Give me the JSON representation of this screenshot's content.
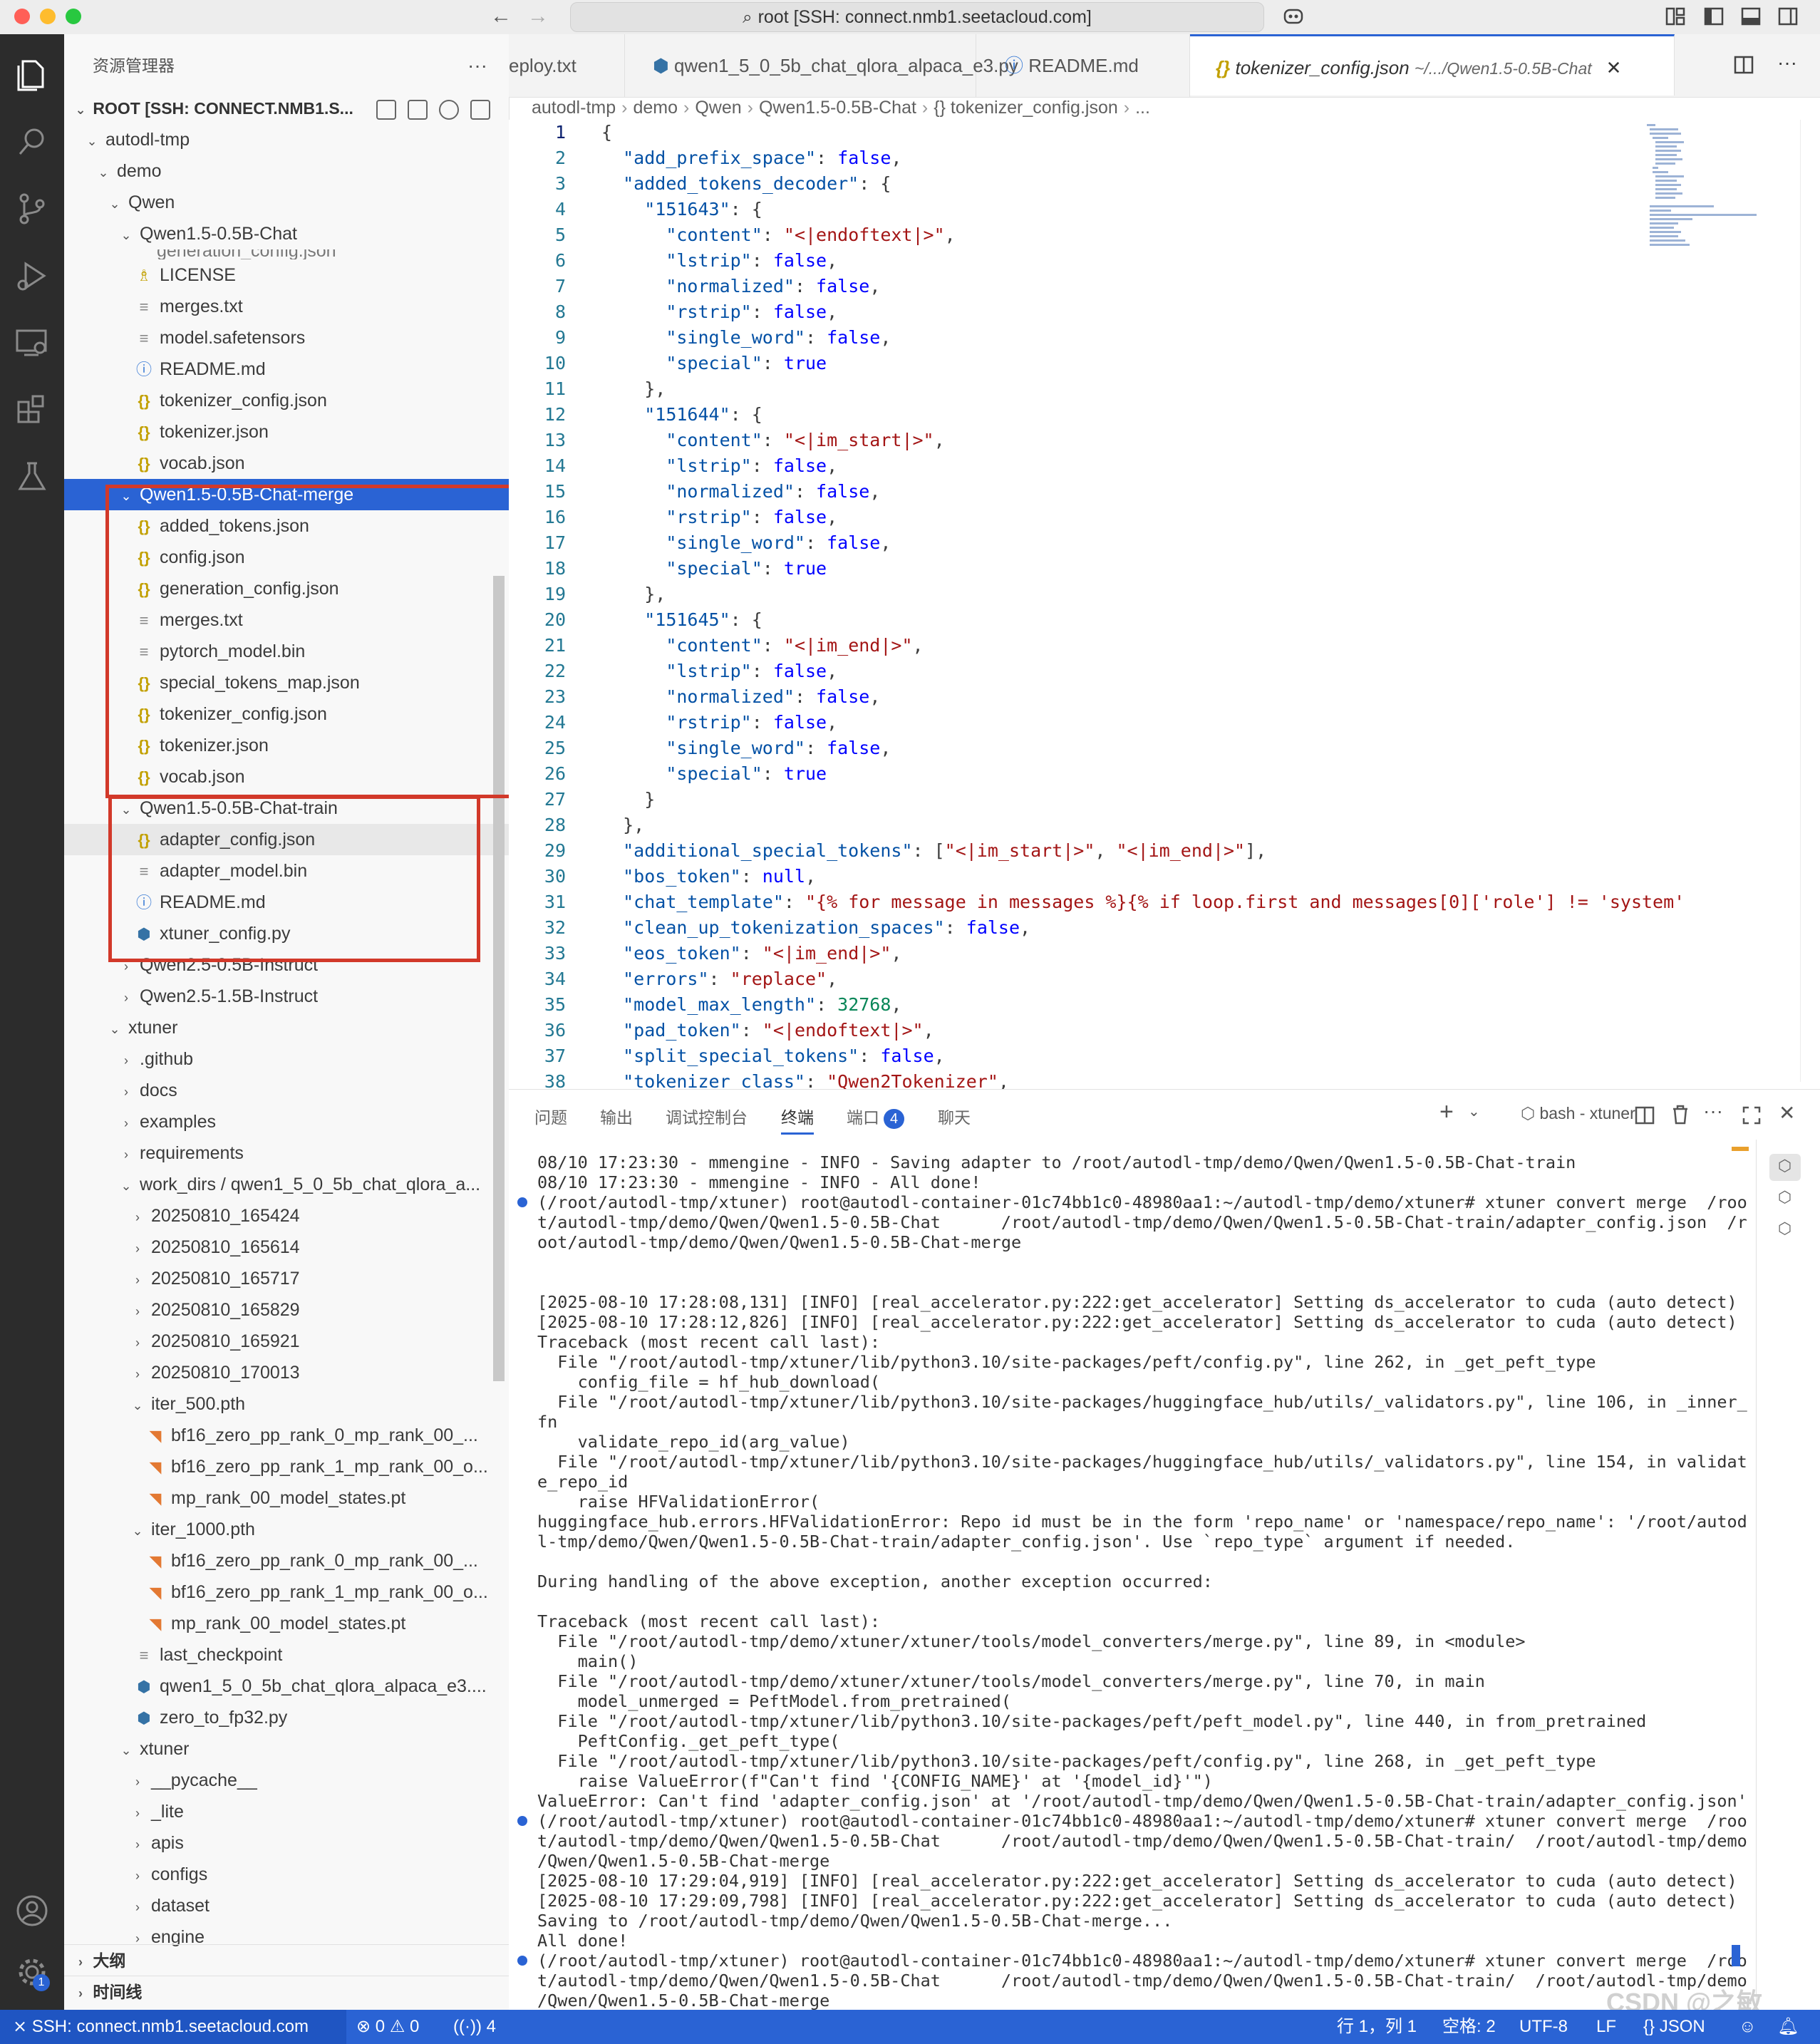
{
  "window": {
    "title": "root [SSH: connect.nmb1.seetacloud.com]",
    "nav_back": "←",
    "nav_forward": "→"
  },
  "sidebar": {
    "header": "资源管理器",
    "more": "···",
    "root_label": "ROOT [SSH: CONNECT.NMB1.S...",
    "tree": [
      {
        "label": "autodl-tmp",
        "indent": 1,
        "kind": "folder-open"
      },
      {
        "label": "demo",
        "indent": 2,
        "kind": "folder-open"
      },
      {
        "label": "Qwen",
        "indent": 3,
        "kind": "folder-open"
      },
      {
        "label": "Qwen1.5-0.5B-Chat",
        "indent": 4,
        "kind": "folder-open"
      },
      {
        "label": "LICENSE",
        "indent": 5,
        "kind": "lic"
      },
      {
        "label": "merges.txt",
        "indent": 5,
        "kind": "txt"
      },
      {
        "label": "model.safetensors",
        "indent": 5,
        "kind": "txt"
      },
      {
        "label": "README.md",
        "indent": 5,
        "kind": "info"
      },
      {
        "label": "tokenizer_config.json",
        "indent": 5,
        "kind": "json"
      },
      {
        "label": "tokenizer.json",
        "indent": 5,
        "kind": "json"
      },
      {
        "label": "vocab.json",
        "indent": 5,
        "kind": "json"
      },
      {
        "label": "Qwen1.5-0.5B-Chat-merge",
        "indent": 4,
        "kind": "folder-open",
        "selected": true
      },
      {
        "label": "added_tokens.json",
        "indent": 5,
        "kind": "json"
      },
      {
        "label": "config.json",
        "indent": 5,
        "kind": "json"
      },
      {
        "label": "generation_config.json",
        "indent": 5,
        "kind": "json"
      },
      {
        "label": "merges.txt",
        "indent": 5,
        "kind": "txt"
      },
      {
        "label": "pytorch_model.bin",
        "indent": 5,
        "kind": "txt"
      },
      {
        "label": "special_tokens_map.json",
        "indent": 5,
        "kind": "json"
      },
      {
        "label": "tokenizer_config.json",
        "indent": 5,
        "kind": "json"
      },
      {
        "label": "tokenizer.json",
        "indent": 5,
        "kind": "json"
      },
      {
        "label": "vocab.json",
        "indent": 5,
        "kind": "json"
      },
      {
        "label": "Qwen1.5-0.5B-Chat-train",
        "indent": 4,
        "kind": "folder-open"
      },
      {
        "label": "adapter_config.json",
        "indent": 5,
        "kind": "json",
        "hover": true
      },
      {
        "label": "adapter_model.bin",
        "indent": 5,
        "kind": "txt"
      },
      {
        "label": "README.md",
        "indent": 5,
        "kind": "info"
      },
      {
        "label": "xtuner_config.py",
        "indent": 5,
        "kind": "py"
      },
      {
        "label": "Qwen2.5-0.5B-Instruct",
        "indent": 4,
        "kind": "folder-closed"
      },
      {
        "label": "Qwen2.5-1.5B-Instruct",
        "indent": 4,
        "kind": "folder-closed"
      },
      {
        "label": "xtuner",
        "indent": 3,
        "kind": "folder-open"
      },
      {
        "label": ".github",
        "indent": 4,
        "kind": "folder-closed"
      },
      {
        "label": "docs",
        "indent": 4,
        "kind": "folder-closed"
      },
      {
        "label": "examples",
        "indent": 4,
        "kind": "folder-closed"
      },
      {
        "label": "requirements",
        "indent": 4,
        "kind": "folder-closed"
      },
      {
        "label": "work_dirs / qwen1_5_0_5b_chat_qlora_a...",
        "indent": 4,
        "kind": "folder-open"
      },
      {
        "label": "20250810_165424",
        "indent": 5,
        "kind": "folder-closed"
      },
      {
        "label": "20250810_165614",
        "indent": 5,
        "kind": "folder-closed"
      },
      {
        "label": "20250810_165717",
        "indent": 5,
        "kind": "folder-closed"
      },
      {
        "label": "20250810_165829",
        "indent": 5,
        "kind": "folder-closed"
      },
      {
        "label": "20250810_165921",
        "indent": 5,
        "kind": "folder-closed"
      },
      {
        "label": "20250810_170013",
        "indent": 5,
        "kind": "folder-closed"
      },
      {
        "label": "iter_500.pth",
        "indent": 5,
        "kind": "folder-open"
      },
      {
        "label": "bf16_zero_pp_rank_0_mp_rank_00_...",
        "indent": 6,
        "kind": "rss"
      },
      {
        "label": "bf16_zero_pp_rank_1_mp_rank_00_o...",
        "indent": 6,
        "kind": "rss"
      },
      {
        "label": "mp_rank_00_model_states.pt",
        "indent": 6,
        "kind": "rss"
      },
      {
        "label": "iter_1000.pth",
        "indent": 5,
        "kind": "folder-open"
      },
      {
        "label": "bf16_zero_pp_rank_0_mp_rank_00_...",
        "indent": 6,
        "kind": "rss"
      },
      {
        "label": "bf16_zero_pp_rank_1_mp_rank_00_o...",
        "indent": 6,
        "kind": "rss"
      },
      {
        "label": "mp_rank_00_model_states.pt",
        "indent": 6,
        "kind": "rss"
      },
      {
        "label": "last_checkpoint",
        "indent": 5,
        "kind": "txt"
      },
      {
        "label": "qwen1_5_0_5b_chat_qlora_alpaca_e3....",
        "indent": 5,
        "kind": "py"
      },
      {
        "label": "zero_to_fp32.py",
        "indent": 5,
        "kind": "py"
      },
      {
        "label": "xtuner",
        "indent": 4,
        "kind": "folder-open"
      },
      {
        "label": "__pycache__",
        "indent": 5,
        "kind": "folder-closed"
      },
      {
        "label": "_lite",
        "indent": 5,
        "kind": "folder-closed"
      },
      {
        "label": "apis",
        "indent": 5,
        "kind": "folder-closed"
      },
      {
        "label": "configs",
        "indent": 5,
        "kind": "folder-closed"
      },
      {
        "label": "dataset",
        "indent": 5,
        "kind": "folder-closed"
      },
      {
        "label": "engine",
        "indent": 5,
        "kind": "folder-closed"
      }
    ],
    "partial_row": "generation_config.json",
    "outline": "大纲",
    "timeline": "时间线"
  },
  "tabs": [
    {
      "label": "eploy.txt",
      "icon": ""
    },
    {
      "label": "qwen1_5_0_5b_chat_qlora_alpaca_e3.py",
      "icon": "py"
    },
    {
      "label": "README.md",
      "icon": "info"
    },
    {
      "label": "tokenizer_config.json",
      "suffix": "~/.../Qwen1.5-0.5B-Chat",
      "icon": "json",
      "active": true
    }
  ],
  "breadcrumb": [
    "autodl-tmp",
    "demo",
    "Qwen",
    "Qwen1.5-0.5B-Chat",
    "{} tokenizer_config.json",
    "..."
  ],
  "code_lines": [
    "{",
    "  \"add_prefix_space\": false,",
    "  \"added_tokens_decoder\": {",
    "    \"151643\": {",
    "      \"content\": \"<|endoftext|>\",",
    "      \"lstrip\": false,",
    "      \"normalized\": false,",
    "      \"rstrip\": false,",
    "      \"single_word\": false,",
    "      \"special\": true",
    "    },",
    "    \"151644\": {",
    "      \"content\": \"<|im_start|>\",",
    "      \"lstrip\": false,",
    "      \"normalized\": false,",
    "      \"rstrip\": false,",
    "      \"single_word\": false,",
    "      \"special\": true",
    "    },",
    "    \"151645\": {",
    "      \"content\": \"<|im_end|>\",",
    "      \"lstrip\": false,",
    "      \"normalized\": false,",
    "      \"rstrip\": false,",
    "      \"single_word\": false,",
    "      \"special\": true",
    "    }",
    "  },",
    "  \"additional_special_tokens\": [\"<|im_start|>\", \"<|im_end|>\"],",
    "  \"bos_token\": null,",
    "  \"chat_template\": \"{% for message in messages %}{% if loop.first and messages[0]['role'] != 'system'",
    "  \"clean_up_tokenization_spaces\": false,",
    "  \"eos_token\": \"<|im_end|>\",",
    "  \"errors\": \"replace\",",
    "  \"model_max_length\": 32768,",
    "  \"pad_token\": \"<|endoftext|>\",",
    "  \"split_special_tokens\": false,",
    "  \"tokenizer_class\": \"Qwen2Tokenizer\","
  ],
  "panel": {
    "tabs": [
      "问题",
      "输出",
      "调试控制台",
      "终端",
      "端口",
      "聊天"
    ],
    "active_tab": "终端",
    "ports_badge": "4",
    "terminal_name": "bash - xtuner",
    "terminal_lines": [
      "08/10 17:23:30 - mmengine - INFO - Saving adapter to /root/autodl-tmp/demo/Qwen/Qwen1.5-0.5B-Chat-train",
      "08/10 17:23:30 - mmengine - INFO - All done!",
      "(/root/autodl-tmp/xtuner) root@autodl-container-01c74bb1c0-48980aa1:~/autodl-tmp/demo/xtuner# xtuner convert merge  /roo",
      "t/autodl-tmp/demo/Qwen/Qwen1.5-0.5B-Chat      /root/autodl-tmp/demo/Qwen/Qwen1.5-0.5B-Chat-train/adapter_config.json  /r",
      "oot/autodl-tmp/demo/Qwen/Qwen1.5-0.5B-Chat-merge",
      "",
      "",
      "[2025-08-10 17:28:08,131] [INFO] [real_accelerator.py:222:get_accelerator] Setting ds_accelerator to cuda (auto detect)",
      "[2025-08-10 17:28:12,826] [INFO] [real_accelerator.py:222:get_accelerator] Setting ds_accelerator to cuda (auto detect)",
      "Traceback (most recent call last):",
      "  File \"/root/autodl-tmp/xtuner/lib/python3.10/site-packages/peft/config.py\", line 262, in _get_peft_type",
      "    config_file = hf_hub_download(",
      "  File \"/root/autodl-tmp/xtuner/lib/python3.10/site-packages/huggingface_hub/utils/_validators.py\", line 106, in _inner_",
      "fn",
      "    validate_repo_id(arg_value)",
      "  File \"/root/autodl-tmp/xtuner/lib/python3.10/site-packages/huggingface_hub/utils/_validators.py\", line 154, in validat",
      "e_repo_id",
      "    raise HFValidationError(",
      "huggingface_hub.errors.HFValidationError: Repo id must be in the form 'repo_name' or 'namespace/repo_name': '/root/autod",
      "l-tmp/demo/Qwen/Qwen1.5-0.5B-Chat-train/adapter_config.json'. Use `repo_type` argument if needed.",
      "",
      "During handling of the above exception, another exception occurred:",
      "",
      "Traceback (most recent call last):",
      "  File \"/root/autodl-tmp/demo/xtuner/xtuner/tools/model_converters/merge.py\", line 89, in <module>",
      "    main()",
      "  File \"/root/autodl-tmp/demo/xtuner/xtuner/tools/model_converters/merge.py\", line 70, in main",
      "    model_unmerged = PeftModel.from_pretrained(",
      "  File \"/root/autodl-tmp/xtuner/lib/python3.10/site-packages/peft/peft_model.py\", line 440, in from_pretrained",
      "    PeftConfig._get_peft_type(",
      "  File \"/root/autodl-tmp/xtuner/lib/python3.10/site-packages/peft/config.py\", line 268, in _get_peft_type",
      "    raise ValueError(f\"Can't find '{CONFIG_NAME}' at '{model_id}'\")",
      "ValueError: Can't find 'adapter_config.json' at '/root/autodl-tmp/demo/Qwen/Qwen1.5-0.5B-Chat-train/adapter_config.json'",
      "(/root/autodl-tmp/xtuner) root@autodl-container-01c74bb1c0-48980aa1:~/autodl-tmp/demo/xtuner# xtuner convert merge  /roo",
      "t/autodl-tmp/demo/Qwen/Qwen1.5-0.5B-Chat      /root/autodl-tmp/demo/Qwen/Qwen1.5-0.5B-Chat-train/  /root/autodl-tmp/demo",
      "/Qwen/Qwen1.5-0.5B-Chat-merge",
      "[2025-08-10 17:29:04,919] [INFO] [real_accelerator.py:222:get_accelerator] Setting ds_accelerator to cuda (auto detect)",
      "[2025-08-10 17:29:09,798] [INFO] [real_accelerator.py:222:get_accelerator] Setting ds_accelerator to cuda (auto detect)",
      "Saving to /root/autodl-tmp/demo/Qwen/Qwen1.5-0.5B-Chat-merge...",
      "All done!",
      "(/root/autodl-tmp/xtuner) root@autodl-container-01c74bb1c0-48980aa1:~/autodl-tmp/demo/xtuner# xtuner convert merge  /roo",
      "t/autodl-tmp/demo/Qwen/Qwen1.5-0.5B-Chat      /root/autodl-tmp/demo/Qwen/Qwen1.5-0.5B-Chat-train/  /root/autodl-tmp/demo",
      "/Qwen/Qwen1.5-0.5B-Chat-merge"
    ]
  },
  "statusbar": {
    "remote": "SSH: connect.nmb1.seetacloud.com",
    "errors": "0",
    "warnings": "0",
    "ports": "4",
    "position": "行 1，列 1",
    "indent": "空格: 2",
    "encoding": "UTF-8",
    "eol": "LF",
    "language": "JSON",
    "notification_count": "1"
  },
  "watermark": "CSDN @之敏",
  "colors": {
    "accent": "#2a63d4",
    "highlight_box": "#d2392a",
    "json_key": "#0451a5",
    "json_string": "#a31515"
  }
}
